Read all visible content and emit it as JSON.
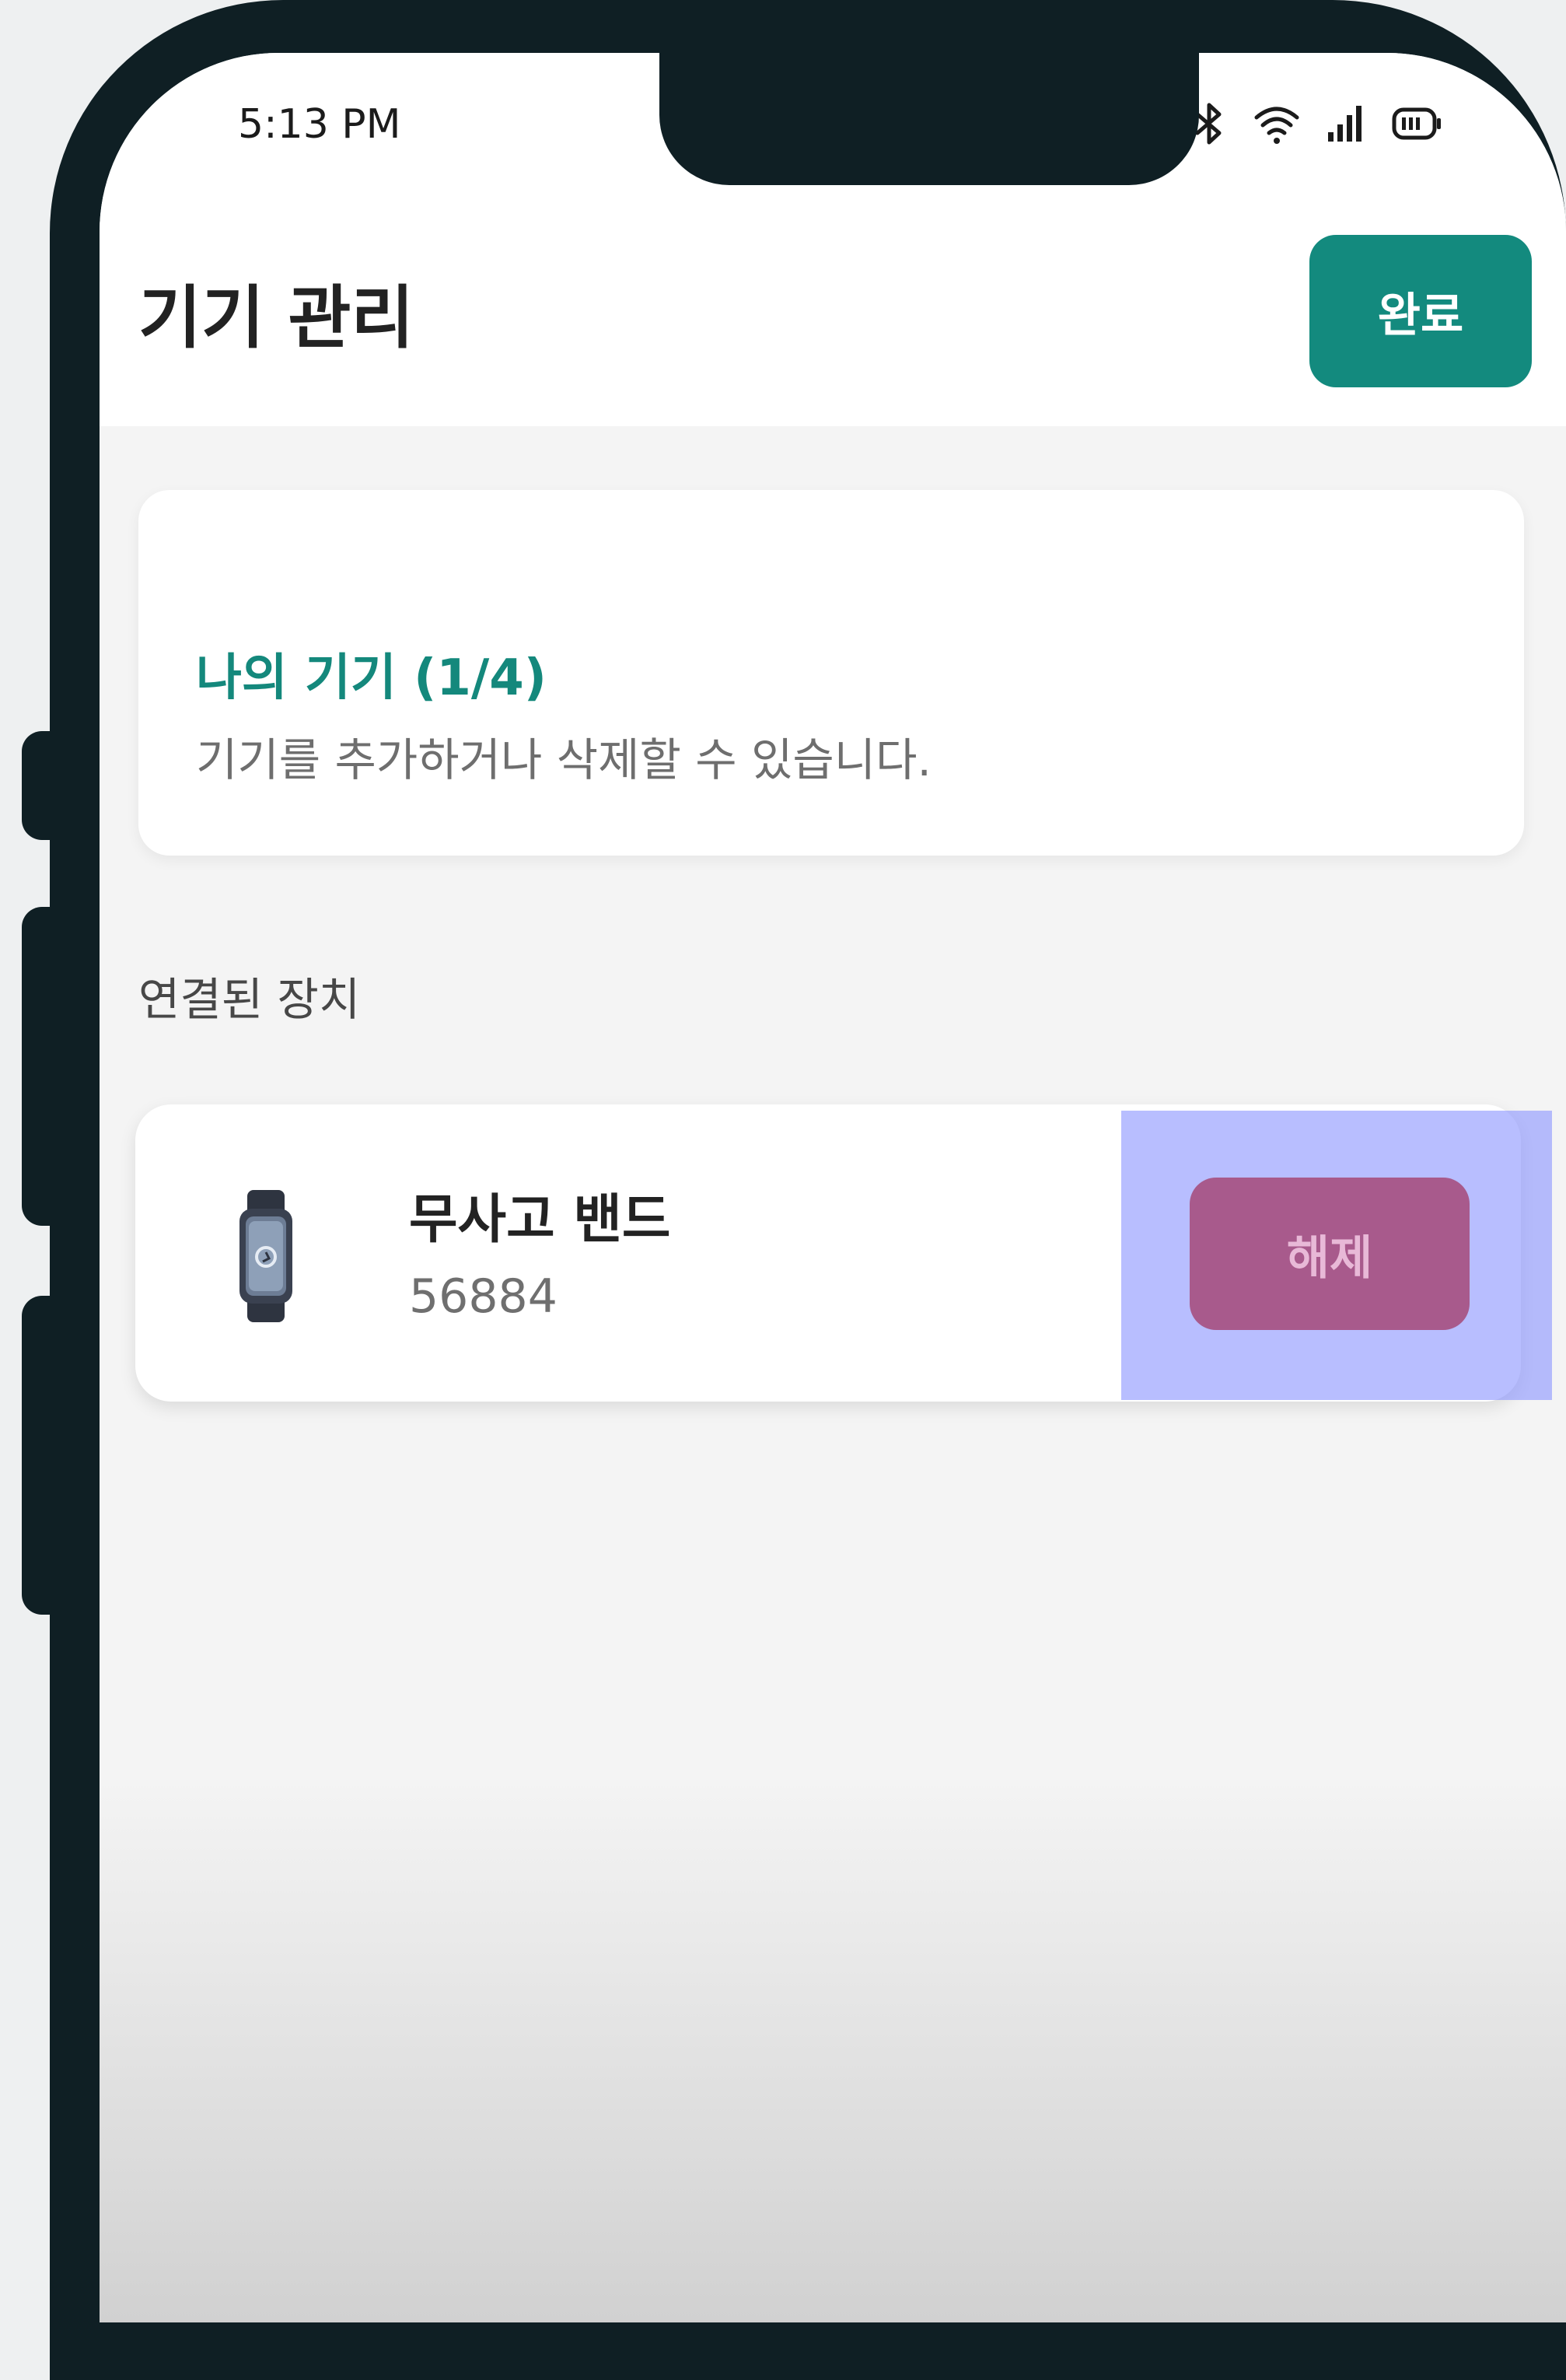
{
  "status_bar": {
    "time": "5:13 PM",
    "icons": [
      "alarm-icon",
      "bluetooth-icon",
      "wifi-icon",
      "signal-icon",
      "battery-icon"
    ]
  },
  "header": {
    "title": "기기 관리",
    "done_label": "완료"
  },
  "info_card": {
    "title": "나의 기기 (1/4)",
    "description": "기기를 추가하거나 삭제할 수 있습니다."
  },
  "section": {
    "connected_label": "연결된 장치"
  },
  "devices": [
    {
      "name": "무사고 밴드",
      "id": "56884",
      "action_label": "해제",
      "icon": "smart-band-icon"
    }
  ],
  "colors": {
    "accent": "#138a7e",
    "accent_text": "#14887c",
    "unlink_button": "#a85a8c",
    "highlight_overlay": "#8c96ff",
    "phone_frame": "#0f1f24"
  }
}
